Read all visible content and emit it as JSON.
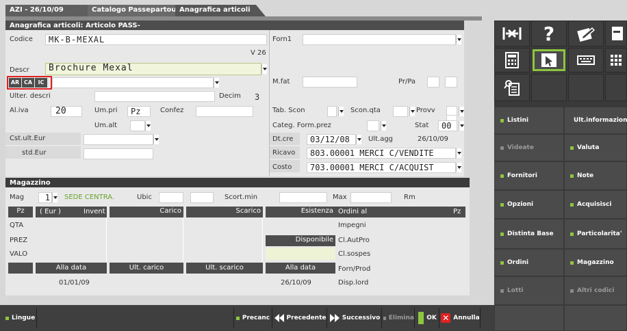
{
  "window": {
    "title": "AZI - 26/10/09",
    "tabs": [
      "Catalogo Passepartout sa.",
      "Anagrafica articoli"
    ]
  },
  "section": {
    "title": "Anagrafica articoli: Articolo PASS-"
  },
  "left": {
    "codice_label": "Codice",
    "codice": "MK-B-MEXAL",
    "version": "V 26",
    "descr_label": "Descr",
    "descr": "Brochure Mexal",
    "lang_buttons": [
      "AR",
      "CA",
      "IC"
    ],
    "ulter_label": "Ulter. descri",
    "decim_label": "Decim",
    "decim": "3",
    "aliva_label": "Al.iva",
    "aliva": "20",
    "umpri_label": "Um.pri",
    "umpri": "Pz",
    "confez_label": "Confez",
    "umalt_label": "Um.alt",
    "cst_label": "Cst.ult.Eur",
    "std_label": "std.Eur"
  },
  "right": {
    "forn1_label": "Forn1",
    "mfat_label": "M.fat",
    "prpa_label": "Pr/Pa",
    "tabscon_label": "Tab. Scon",
    "sconqta_label": "Scon.qta",
    "provv_label": "Provv",
    "categ_label": "Categ. Form.prez",
    "stat_label": "Stat",
    "stat": "00",
    "dtcre_label": "Dt.cre",
    "dtcre": "03/12/08",
    "ultagg_label": "Ult.agg",
    "ultagg": "26/10/09",
    "ricavo_label": "Ricavo",
    "ricavo": "803.00001 MERCI C/VENDITE",
    "costo_label": "Costo",
    "costo": "703.00001 MERCI C/ACQUIST"
  },
  "magazzino": {
    "title": "Magazzino",
    "mag_label": "Mag",
    "mag": "1",
    "sede": "SEDE CENTRA.",
    "ubic_label": "Ubic",
    "scortmin_label": "Scort.min",
    "max_label": "Max",
    "rm_label": "Rm",
    "col_pz": "Pz",
    "col_eur": "( Eur )",
    "col_invent": "Invent",
    "col_carico": "Carico",
    "col_scarico": "Scarico",
    "col_esistenza": "Esistenza",
    "col_ordini": "Ordini al",
    "col_pz2": "Pz",
    "rows": [
      "QTA",
      "PREZ",
      "VALO"
    ],
    "right_list": [
      "Impegni",
      "Cl.AutPro",
      "Cl.sospes",
      "Forn/Prod",
      "Disp.lord"
    ],
    "disponibile": "Disponibile",
    "alladata": "Alla data",
    "ultcarico": "Ult. carico",
    "ultscarico": "Ult. scarico",
    "alladata2": "Alla data",
    "date1": "01/01/09",
    "date2": "26/10/09"
  },
  "sidebar": {
    "buttons": [
      {
        "label": "Listini",
        "enabled": true
      },
      {
        "label": "Ult.informazioni",
        "enabled": true
      },
      {
        "label": "Videate",
        "enabled": false
      },
      {
        "label": "Valuta",
        "enabled": true
      },
      {
        "label": "Fornitori",
        "enabled": true
      },
      {
        "label": "Note",
        "enabled": true
      },
      {
        "label": "Opzioni",
        "enabled": true
      },
      {
        "label": "Acquisisci",
        "enabled": true
      },
      {
        "label": "Distinta Base",
        "enabled": true
      },
      {
        "label": "Particolarita'",
        "enabled": true
      },
      {
        "label": "Ordini",
        "enabled": true
      },
      {
        "label": "Magazzino",
        "enabled": true
      },
      {
        "label": "Lotti",
        "enabled": false
      },
      {
        "label": "Altri codici",
        "enabled": false
      }
    ]
  },
  "bottom": {
    "lingue": "Lingue",
    "precanc": "Precanc",
    "precedente": "Precedente",
    "successivo": "Successivo",
    "elimina": "Elimina",
    "ok": "OK",
    "annulla": "Annulla"
  },
  "colors": {
    "accent_green": "#8ec640",
    "highlight_red": "#e02020"
  }
}
